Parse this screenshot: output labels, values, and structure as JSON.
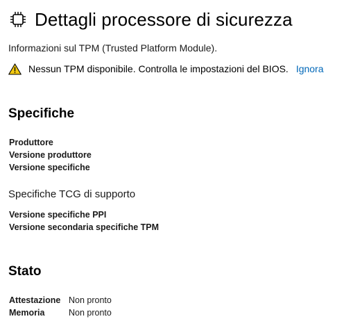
{
  "header": {
    "icon": "chip-icon",
    "title": "Dettagli processore di sicurezza"
  },
  "subtitle": "Informazioni sul TPM (Trusted Platform Module).",
  "warning": {
    "icon": "warning-icon",
    "text": "Nessun TPM disponibile. Controlla le impostazioni del BIOS.",
    "link": "Ignora",
    "color": "#f2c811"
  },
  "specifiche": {
    "title": "Specifiche",
    "fields": [
      "Produttore",
      "Versione produttore",
      "Versione specifiche"
    ],
    "tcg_heading": "Specifiche TCG di supporto",
    "tcg_fields": [
      "Versione specifiche PPI",
      "Versione secondaria specifiche TPM"
    ]
  },
  "stato": {
    "title": "Stato",
    "rows": [
      {
        "label": "Attestazione",
        "value": "Non pronto"
      },
      {
        "label": "Memoria",
        "value": "Non pronto"
      }
    ]
  },
  "colors": {
    "link": "#0067b8",
    "text": "#000000"
  }
}
